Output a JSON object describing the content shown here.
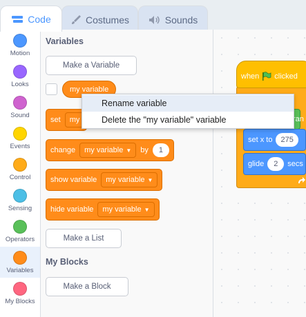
{
  "tabs": [
    {
      "label": "Code",
      "icon": "code-icon"
    },
    {
      "label": "Costumes",
      "icon": "paintbrush-icon"
    },
    {
      "label": "Sounds",
      "icon": "speaker-icon"
    }
  ],
  "categories": [
    {
      "label": "Motion",
      "color": "#4c97ff"
    },
    {
      "label": "Looks",
      "color": "#9966ff"
    },
    {
      "label": "Sound",
      "color": "#cf63cf"
    },
    {
      "label": "Events",
      "color": "#ffd500"
    },
    {
      "label": "Control",
      "color": "#ffab19"
    },
    {
      "label": "Sensing",
      "color": "#4cbfe6"
    },
    {
      "label": "Operators",
      "color": "#59c059"
    },
    {
      "label": "Variables",
      "color": "#ff8c1a"
    },
    {
      "label": "My Blocks",
      "color": "#ff6680"
    }
  ],
  "palette": {
    "variables_heading": "Variables",
    "make_variable": "Make a Variable",
    "variable_reporter": "my variable",
    "set_block": {
      "verb": "set",
      "var": "my"
    },
    "change_block": {
      "verb": "change",
      "var": "my variable",
      "by": "by",
      "value": "1"
    },
    "show_block": {
      "verb": "show variable",
      "var": "my variable"
    },
    "hide_block": {
      "verb": "hide variable",
      "var": "my variable"
    },
    "make_list": "Make a List",
    "myblocks_heading": "My Blocks",
    "make_block": "Make a Block"
  },
  "context_menu": {
    "items": [
      "Rename variable",
      "Delete the \"my variable\" variable"
    ]
  },
  "workspace": {
    "hat_label": "when",
    "hat_suffix": "clicked",
    "green_suffix": "ran",
    "setx_label": "set x to",
    "setx_value": "275",
    "glide_label": "glide",
    "glide_value": "2",
    "glide_suffix": "secs"
  }
}
